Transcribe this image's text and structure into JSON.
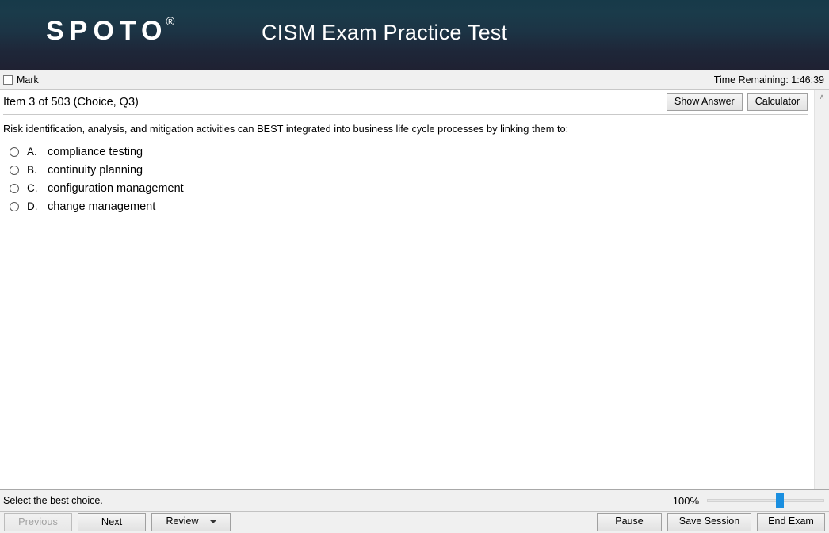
{
  "header": {
    "logo_text": "SPOTO",
    "logo_registered": "®",
    "title": "CISM Exam Practice Test",
    "gradient_top": "#173a49",
    "gradient_bottom": "#1f2132"
  },
  "mark_bar": {
    "mark_label": "Mark",
    "mark_checked": false,
    "time_remaining": "Time Remaining: 1:46:39"
  },
  "item": {
    "label": "Item 3 of 503 (Choice, Q3)",
    "show_answer_label": "Show Answer",
    "calculator_label": "Calculator"
  },
  "question": {
    "text": "Risk identification, analysis, and mitigation activities can BEST integrated into business life cycle processes by linking them to:",
    "choices": [
      {
        "letter": "A.",
        "text": "compliance testing",
        "selected": false
      },
      {
        "letter": "B.",
        "text": "continuity planning",
        "selected": false
      },
      {
        "letter": "C.",
        "text": "configuration management",
        "selected": false
      },
      {
        "letter": "D.",
        "text": "change management",
        "selected": false
      }
    ]
  },
  "scrollbar": {
    "up_arrow_glyph": "∧"
  },
  "status": {
    "hint": "Select the best choice.",
    "zoom_level": "100%",
    "zoom_thumb_percent": 62
  },
  "nav": {
    "previous_label": "Previous",
    "previous_disabled": true,
    "next_label": "Next",
    "review_label": "Review",
    "pause_label": "Pause",
    "save_session_label": "Save Session",
    "end_exam_label": "End Exam"
  }
}
